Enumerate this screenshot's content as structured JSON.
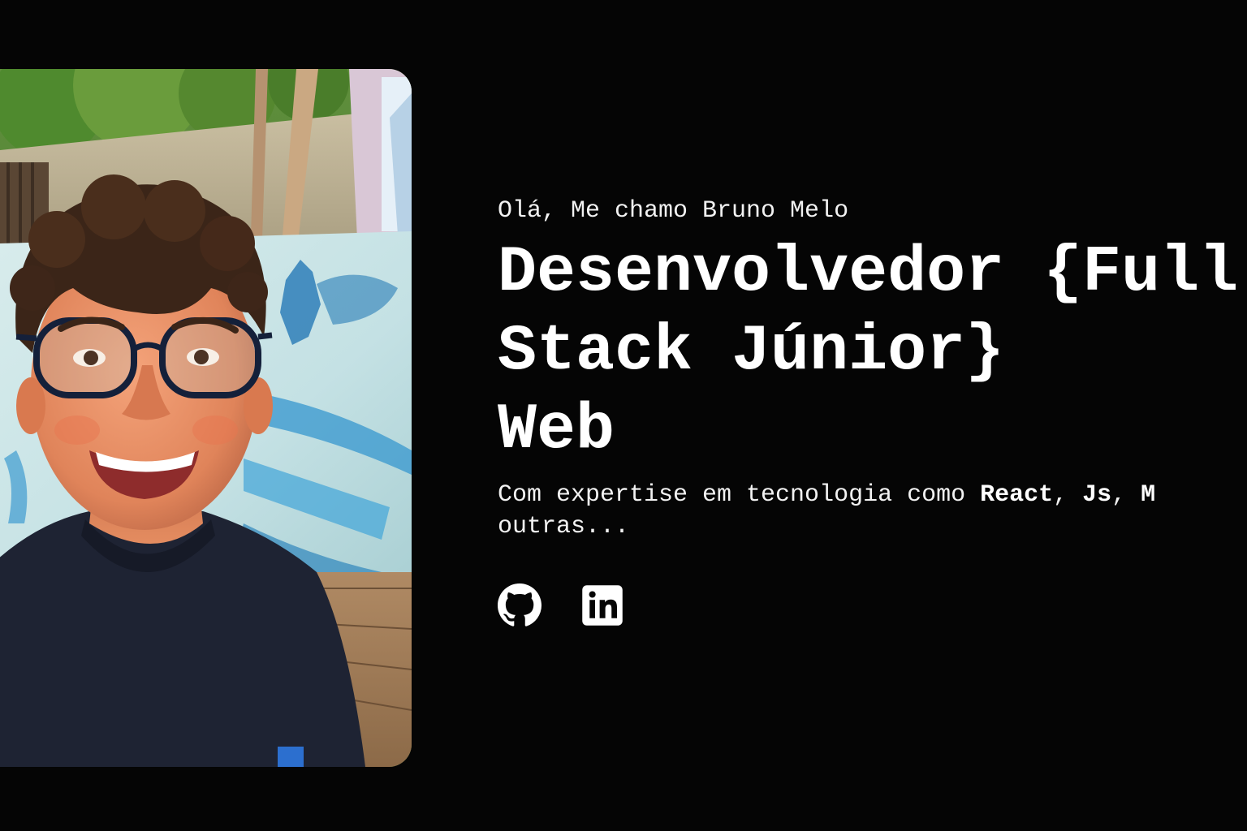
{
  "hero": {
    "greeting": "Olá, Me chamo Bruno Melo",
    "headline_line1": "Desenvolvedor {Full",
    "headline_line2": "Stack Júnior}",
    "headline_line3": "Web",
    "description_prefix": "Com expertise em tecnologia como ",
    "skill_1": "React",
    "separator_1": ", ",
    "skill_2": "Js",
    "separator_2": ", ",
    "skill_3": "M",
    "description_suffix": "outras..."
  },
  "socials": [
    {
      "icon": "github-icon"
    },
    {
      "icon": "linkedin-icon"
    }
  ],
  "colors": {
    "background": "#050505",
    "text": "#ffffff"
  }
}
